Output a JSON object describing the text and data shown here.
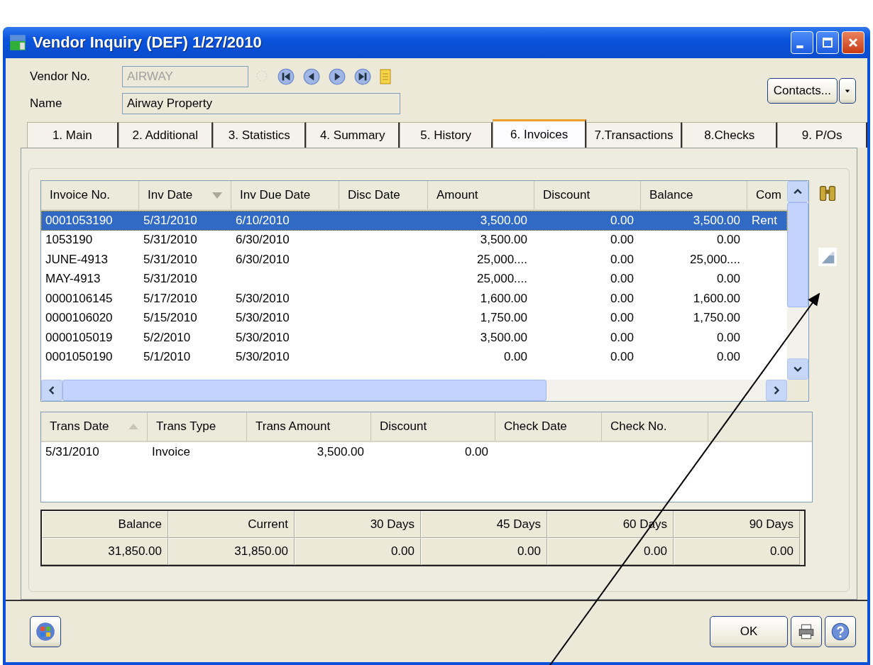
{
  "window": {
    "title": "Vendor Inquiry (DEF) 1/27/2010"
  },
  "vendor_no": {
    "label": "Vendor No.",
    "value": "AIRWAY",
    "disabled": true
  },
  "name": {
    "label": "Name",
    "value": "Airway Property"
  },
  "contacts_button": {
    "label": "Contacts..."
  },
  "tabs": [
    {
      "label": "1. Main",
      "selected": false
    },
    {
      "label": "2. Additional",
      "selected": false
    },
    {
      "label": "3. Statistics",
      "selected": false
    },
    {
      "label": "4. Summary",
      "selected": false
    },
    {
      "label": "5. History",
      "selected": false
    },
    {
      "label": "6. Invoices",
      "selected": true
    },
    {
      "label": "7.Transactions",
      "selected": false
    },
    {
      "label": "8.Checks",
      "selected": false
    },
    {
      "label": "9. P/Os",
      "selected": false
    }
  ],
  "invoices": {
    "columns": [
      {
        "label": "Invoice No.",
        "kind": "text"
      },
      {
        "label": "Inv Date",
        "kind": "text",
        "sort_descending": true
      },
      {
        "label": "Inv Due Date",
        "kind": "text"
      },
      {
        "label": "Disc Date",
        "kind": "text"
      },
      {
        "label": "Amount",
        "kind": "number"
      },
      {
        "label": "Discount",
        "kind": "number"
      },
      {
        "label": "Balance",
        "kind": "number"
      },
      {
        "label": "Com",
        "kind": "text"
      }
    ],
    "rows": [
      {
        "selected": true,
        "cells": [
          "0001053190",
          "5/31/2010",
          "6/10/2010",
          "",
          "3,500.00",
          "0.00",
          "3,500.00",
          "Rent"
        ]
      },
      {
        "selected": false,
        "cells": [
          "1053190",
          "5/31/2010",
          "6/30/2010",
          "",
          "3,500.00",
          "0.00",
          "0.00",
          ""
        ]
      },
      {
        "selected": false,
        "cells": [
          "JUNE-4913",
          "5/31/2010",
          "6/30/2010",
          "",
          "25,000....",
          "0.00",
          "25,000....",
          ""
        ]
      },
      {
        "selected": false,
        "cells": [
          "MAY-4913",
          "5/31/2010",
          "",
          "",
          "25,000....",
          "0.00",
          "0.00",
          ""
        ]
      },
      {
        "selected": false,
        "cells": [
          "0000106145",
          "5/17/2010",
          "5/30/2010",
          "",
          "1,600.00",
          "0.00",
          "1,600.00",
          ""
        ]
      },
      {
        "selected": false,
        "cells": [
          "0000106020",
          "5/15/2010",
          "5/30/2010",
          "",
          "1,750.00",
          "0.00",
          "1,750.00",
          ""
        ]
      },
      {
        "selected": false,
        "cells": [
          "0000105019",
          "5/2/2010",
          "5/30/2010",
          "",
          "3,500.00",
          "0.00",
          "0.00",
          ""
        ]
      },
      {
        "selected": false,
        "cells": [
          "0001050190",
          "5/1/2010",
          "5/30/2010",
          "",
          "0.00",
          "0.00",
          "0.00",
          ""
        ]
      }
    ]
  },
  "transactions": {
    "columns": [
      {
        "label": "Trans Date",
        "kind": "text",
        "sort_ascending": true
      },
      {
        "label": "Trans Type",
        "kind": "text"
      },
      {
        "label": "Trans Amount",
        "kind": "number"
      },
      {
        "label": "Discount",
        "kind": "number"
      },
      {
        "label": "Check Date",
        "kind": "text"
      },
      {
        "label": "Check No.",
        "kind": "text"
      }
    ],
    "rows": [
      {
        "cells": [
          "5/31/2010",
          "Invoice",
          "3,500.00",
          "0.00",
          "",
          ""
        ]
      }
    ]
  },
  "aging": {
    "columns": [
      "Balance",
      "Current",
      "30 Days",
      "45 Days",
      "60 Days",
      "90 Days"
    ],
    "values": [
      "31,850.00",
      "31,850.00",
      "0.00",
      "0.00",
      "0.00",
      "0.00"
    ]
  },
  "ok_button": {
    "label": "OK"
  }
}
